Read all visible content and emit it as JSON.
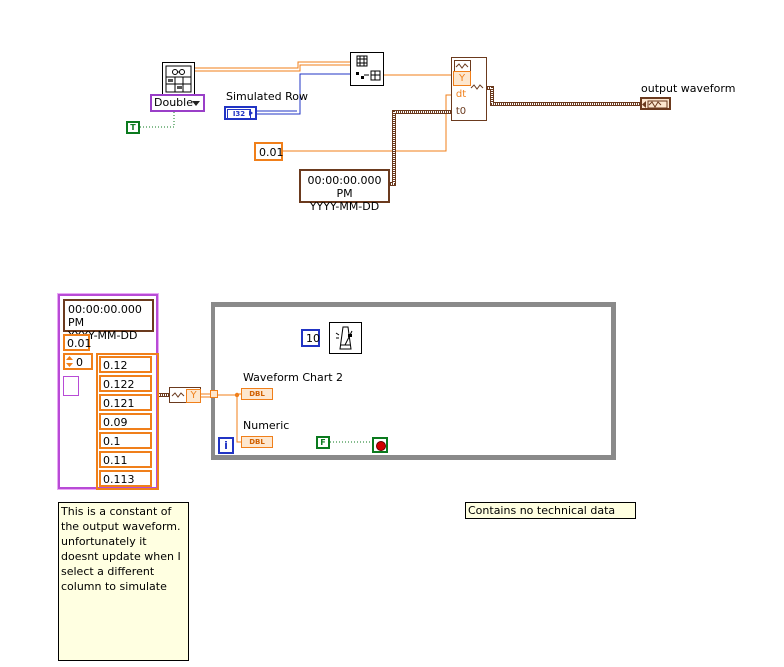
{
  "dropdown": {
    "value": "Double"
  },
  "bool_true": "T",
  "bool_false": "F",
  "simulated_row": {
    "label": "Simulated Row",
    "type": "I32"
  },
  "dt_const": "0.01",
  "timestamp_top": {
    "line1": "00:00:00.000 PM",
    "line2": "YYYY-MM-DD"
  },
  "build_waveform": {
    "y": "Y",
    "dt": "dt",
    "t0": "t0"
  },
  "output_waveform": {
    "label": "output waveform"
  },
  "waveform_const": {
    "t0_line1": "00:00:00.000 PM",
    "t0_line2": "YYYY-MM-DD",
    "dt": "0.01",
    "index": "0",
    "values": [
      "0.12",
      "0.122",
      "0.121",
      "0.09",
      "0.1",
      "0.11",
      "0.113"
    ]
  },
  "unbundle": {
    "y": "Y"
  },
  "loop": {
    "iteration": "i"
  },
  "waveform_chart": {
    "label": "Waveform Chart 2",
    "type": "DBL"
  },
  "numeric": {
    "label": "Numeric",
    "type": "DBL"
  },
  "wait_ms": "10",
  "comment_note": "This is a constant of the output waveform. unfortunately it doesnt update when I select a different column to simulate",
  "info_note": "Contains no technical data",
  "colors": {
    "orange": "#f07f1a",
    "blue": "#2134c4",
    "brown": "#6b3a1e",
    "green": "#0b7a1e",
    "loop_gray": "#8a8a8a"
  }
}
